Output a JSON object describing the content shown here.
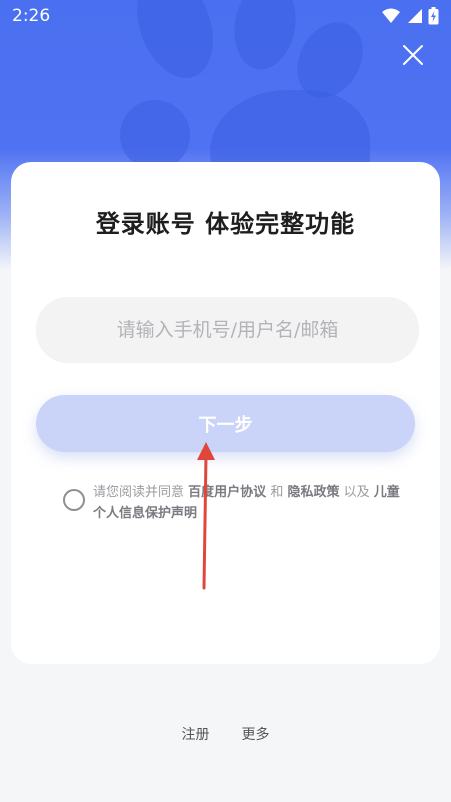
{
  "status_bar": {
    "time": "2:26"
  },
  "icons": {
    "wifi": "wifi-icon",
    "signal": "signal-icon",
    "battery": "battery-icon",
    "close": "close-icon",
    "checkbox": "radio-circle-icon"
  },
  "login": {
    "title": "登录账号 体验完整功能",
    "input_placeholder": "请输入手机号/用户名/邮箱",
    "input_value": "",
    "next_label": "下一步"
  },
  "agreement": {
    "prefix": "请您阅读并同意",
    "link1": "百度用户协议",
    "and": "和",
    "link2": "隐私政策",
    "and2": "以及",
    "link3": "儿童个人信息保护声明"
  },
  "footer": {
    "register": "注册",
    "more": "更多"
  },
  "colors": {
    "brand_blue": "#4a6ff0",
    "button_disabled": "#c9d4f8",
    "annotation_arrow": "#e0463a"
  }
}
